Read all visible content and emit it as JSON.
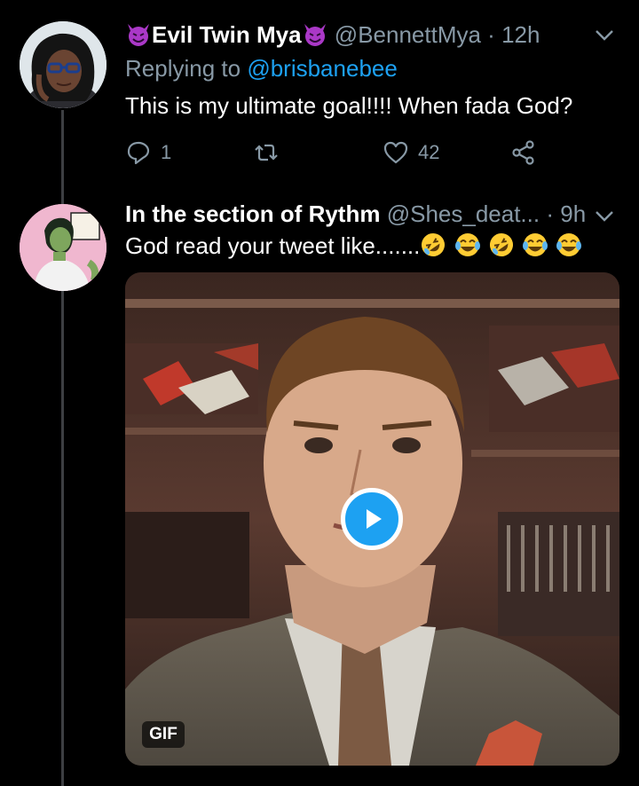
{
  "colors": {
    "background": "#000000",
    "text": "#ffffff",
    "secondary_text": "#8899a6",
    "link": "#1da1f2",
    "thread_line": "#3d3f42"
  },
  "tweet1": {
    "display_name": "Evil Twin Mya",
    "name_emoji_icon": "smiling-devil-icon",
    "handle": "@BennettMya",
    "separator": "·",
    "time": "12h",
    "replying_prefix": "Replying to",
    "replying_to": "@brisbanebee",
    "text": "This is my ultimate goal!!!! When fada God?",
    "actions": {
      "reply_icon": "reply-icon",
      "reply_count": "1",
      "retweet_icon": "retweet-icon",
      "retweet_count": "",
      "like_icon": "heart-icon",
      "like_count": "42",
      "share_icon": "share-icon"
    }
  },
  "tweet2": {
    "display_name": "In the section of Rythm",
    "handle": "@Shes_deat...",
    "separator": "·",
    "time": "9h",
    "text": "God  read your tweet like.......",
    "text_emojis": [
      "rolling-on-floor-laughing-icon",
      "tears-of-joy-icon",
      "rolling-on-floor-laughing-icon",
      "tears-of-joy-icon",
      "tears-of-joy-icon"
    ],
    "media": {
      "type": "gif",
      "play_icon": "play-icon",
      "badge": "GIF"
    }
  }
}
